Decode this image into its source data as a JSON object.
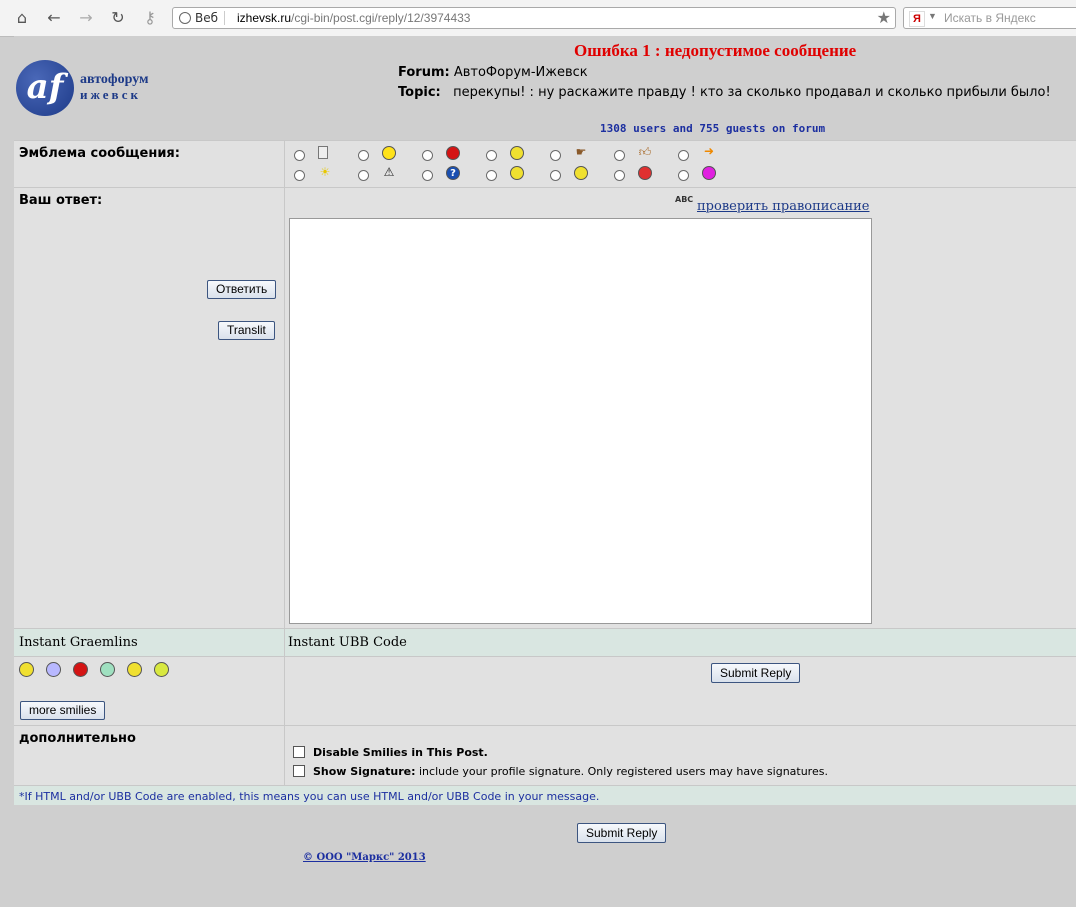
{
  "browser": {
    "url_label": "Веб",
    "url_host": "izhevsk.ru",
    "url_path": "/cgi-bin/post.cgi/reply/12/3974433",
    "search_placeholder": "Искать в Яндекс",
    "search_engine_glyph": "Я"
  },
  "header": {
    "logo_glyph": "af",
    "logo_line1": "автофорум",
    "logo_line2": "ижевск",
    "error_title": "Ошибка 1 : недопустимое сообщение",
    "forum_label": "Forum:",
    "forum_value": "АвтоФорум-Ижевск",
    "topic_label": "Topic:",
    "topic_value": "перекупы! : ну раскажите правду ! кто за сколько продавал и сколько прибыли было!",
    "online": "1308 users and 755 guests on forum"
  },
  "emblem": {
    "label": "Эмблема сообщения:",
    "icons": [
      "note-icon",
      "grin-icon",
      "stop-icon",
      "smile-icon",
      "hand-point-icon",
      "thumbs-up-icon",
      "arrow-right-icon",
      "lightbulb-icon",
      "warning-icon",
      "question-icon",
      "cool-icon",
      "happy-icon",
      "angry-icon",
      "purple-face-icon"
    ]
  },
  "reply": {
    "label": "Ваш ответ:",
    "answer_button": "Ответить",
    "translit_button": "Translit",
    "spell_link": "проверить правописание",
    "spell_icon": "ABC"
  },
  "instant": {
    "graemlins_label": "Instant Graemlins",
    "ubb_label": "Instant UBB Code",
    "more_smilies": "more smilies",
    "submit_label": "Submit Reply"
  },
  "options": {
    "label": "дополнительно",
    "disable_smilies": "Disable Smilies in This Post.",
    "show_signature_label": "Show Signature:",
    "show_signature_desc": "include your profile signature. Only registered users may have signatures."
  },
  "note": "*If HTML and/or UBB Code are enabled, this means you can use HTML and/or UBB Code in your message.",
  "bottom_submit": "Submit Reply",
  "footer": "© ООО \"Маркс\" 2013"
}
